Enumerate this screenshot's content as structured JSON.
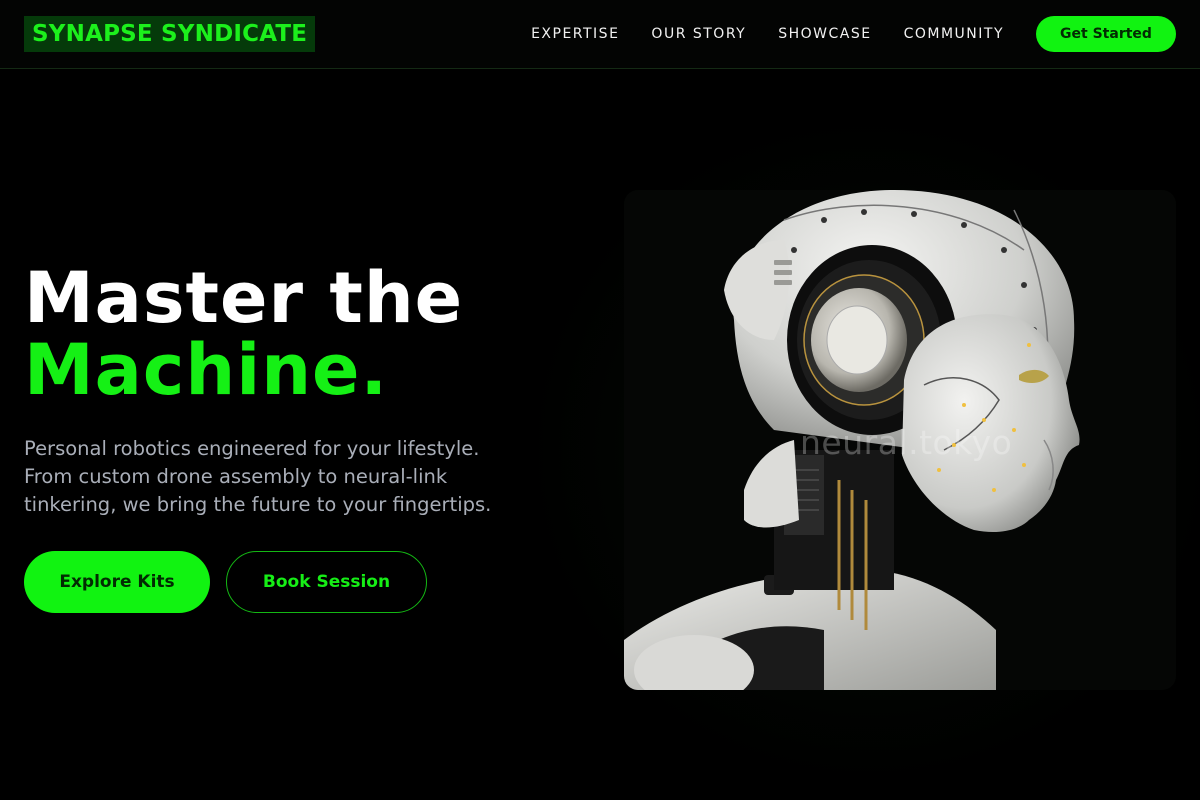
{
  "header": {
    "logo_text": "SYNAPSE SYNDICATE",
    "nav": [
      {
        "label": "EXPERTISE"
      },
      {
        "label": "OUR STORY"
      },
      {
        "label": "SHOWCASE"
      },
      {
        "label": "COMMUNITY"
      }
    ],
    "cta_label": "Get Started"
  },
  "hero": {
    "headline_line1": "Master the",
    "headline_line2": "Machine.",
    "subtext": "Personal robotics engineered for your lifestyle. From custom drone assembly to neural-link tinkering, we bring the future to your fingertips.",
    "primary_button": "Explore Kits",
    "secondary_button": "Book Session",
    "image_watermark": "neural.tokyo"
  },
  "colors": {
    "accent": "#11f311",
    "background": "#000000",
    "text_muted": "#a9aeb8"
  }
}
